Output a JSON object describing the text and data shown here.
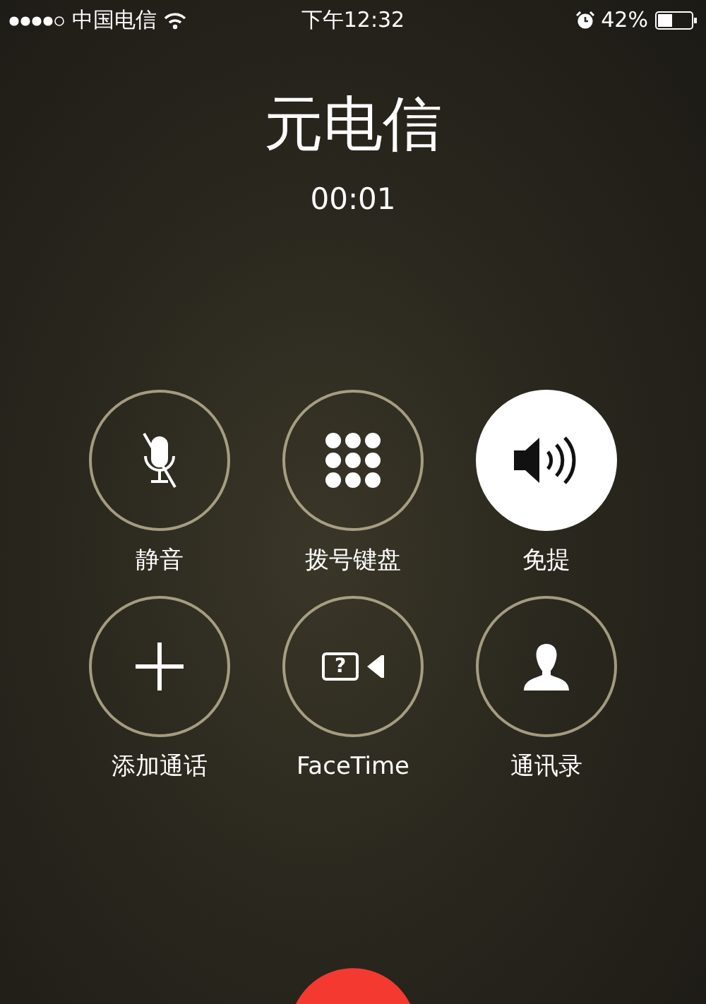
{
  "status_bar": {
    "carrier": "中国电信",
    "time": "下午12:32",
    "battery": "42%"
  },
  "call": {
    "name": "元电信",
    "duration": "00:01"
  },
  "buttons": [
    {
      "kind": "mute",
      "label": "静音",
      "selected": false
    },
    {
      "kind": "keypad",
      "label": "拨号键盘",
      "selected": false
    },
    {
      "kind": "speaker",
      "label": "免提",
      "selected": true
    },
    {
      "kind": "add",
      "label": "添加通话",
      "selected": false
    },
    {
      "kind": "facetime",
      "label": "FaceTime",
      "selected": false,
      "icon_text": "?"
    },
    {
      "kind": "contacts",
      "label": "通讯录",
      "selected": false
    }
  ]
}
